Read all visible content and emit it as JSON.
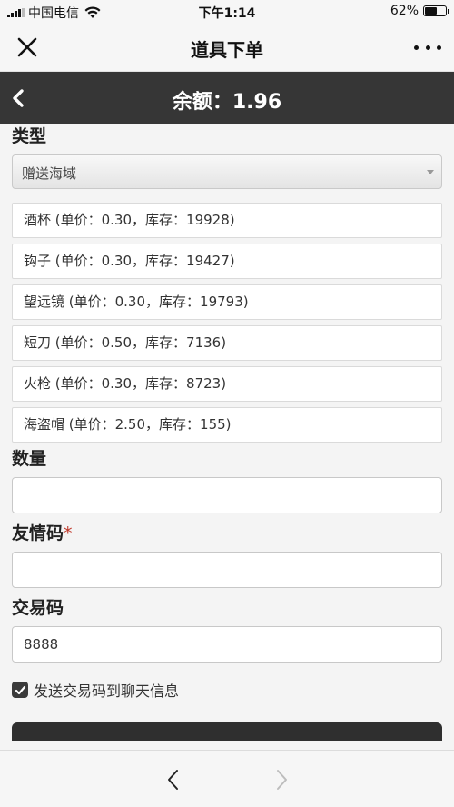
{
  "status_bar": {
    "carrier": "中国电信",
    "time": "下午1:14",
    "battery_percent": "62%",
    "battery_level": 0.62
  },
  "nav": {
    "title": "道具下单",
    "close_icon": "close-icon",
    "more_icon": "more-icon"
  },
  "balance": {
    "text": "余额：1.96"
  },
  "form": {
    "type_label": "类型",
    "type_selected": "赠送海域",
    "items": [
      {
        "label": "酒杯 (单价：0.30，库存：19928)"
      },
      {
        "label": "钩子 (单价：0.30，库存：19427)"
      },
      {
        "label": "望远镜 (单价：0.30，库存：19793)"
      },
      {
        "label": "短刀 (单价：0.50，库存：7136)"
      },
      {
        "label": "火枪 (单价：0.30，库存：8723)"
      },
      {
        "label": "海盗帽 (单价：2.50，库存：155)"
      }
    ],
    "quantity_label": "数量",
    "quantity_value": "",
    "friend_code_label": "友情码",
    "friend_code_required": "*",
    "friend_code_value": "",
    "trade_code_label": "交易码",
    "trade_code_value": "8888",
    "checkbox_label": "发送交易码到聊天信息",
    "checkbox_checked": true
  },
  "colors": {
    "header_dark": "#363636",
    "required_red": "#c0392b"
  }
}
